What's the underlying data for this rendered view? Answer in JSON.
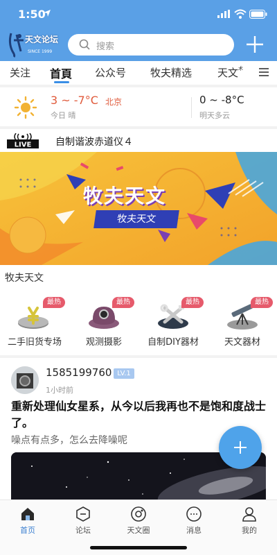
{
  "status": {
    "time": "1:50"
  },
  "header": {
    "logo_text": "天文论坛",
    "logo_since": "SINCE 1999",
    "search_placeholder": "搜索"
  },
  "tabs": [
    {
      "label": "关注"
    },
    {
      "label": "首頁"
    },
    {
      "label": "公众号"
    },
    {
      "label": "牧夫精选"
    },
    {
      "label": "天文",
      "suffix": "术"
    }
  ],
  "weather": {
    "today_temp": "3 ~ -7°C",
    "city": "北京",
    "today_desc": "今日 晴",
    "tomorrow_temp": "0 ~ -8°C",
    "tomorrow_desc": "明天多云"
  },
  "live": {
    "badge": "LIVE",
    "title": "自制谐波赤道仪４"
  },
  "banner": {
    "title": "牧夫天文",
    "subtitle": "牧夫天文"
  },
  "section": {
    "title": "牧夫天文",
    "categories": [
      {
        "label": "二手旧货专场",
        "badge": "最热"
      },
      {
        "label": "观测摄影",
        "badge": "最热"
      },
      {
        "label": "自制DIY器材",
        "badge": "最热"
      },
      {
        "label": "天文器材",
        "badge": "最热"
      }
    ]
  },
  "post": {
    "username": "1585199760",
    "level": "LV.1",
    "time": "1小时前",
    "title": "重新处理仙女星系，从今以后我再也不是饱和度战士了。",
    "body": "噪点有点多，怎么去降噪呢"
  },
  "bottom_nav": [
    {
      "label": "首页",
      "active": true
    },
    {
      "label": "论坛"
    },
    {
      "label": "天文圈"
    },
    {
      "label": "消息"
    },
    {
      "label": "我的"
    }
  ],
  "colors": {
    "header_bg": "#5aa0e6",
    "accent": "#3a8ee6",
    "hot_badge": "#e65a6b",
    "temp_red": "#e05a3b"
  }
}
